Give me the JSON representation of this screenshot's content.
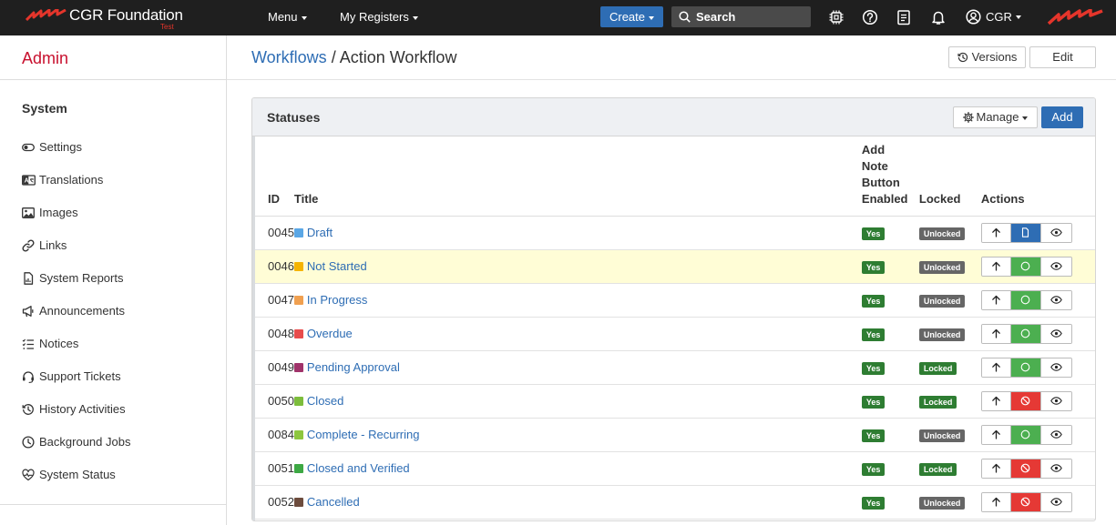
{
  "topbar": {
    "brand_name": "CGR Foundation",
    "brand_sub": "Test",
    "menu_label": "Menu",
    "registers_label": "My Registers",
    "create_label": "Create",
    "search_placeholder": "Search",
    "user_label": "CGR",
    "icons": [
      "chip-icon",
      "help-icon",
      "clipboard-icon",
      "bell-icon",
      "user-circle-icon"
    ]
  },
  "sidebar": {
    "title": "Admin",
    "section": "System",
    "items": [
      {
        "label": "Settings",
        "icon": "toggle-icon"
      },
      {
        "label": "Translations",
        "icon": "translate-icon"
      },
      {
        "label": "Images",
        "icon": "image-icon"
      },
      {
        "label": "Links",
        "icon": "link-icon"
      },
      {
        "label": "System Reports",
        "icon": "report-icon"
      },
      {
        "label": "Announcements",
        "icon": "megaphone-icon"
      },
      {
        "label": "Notices",
        "icon": "list-icon"
      },
      {
        "label": "Support Tickets",
        "icon": "headset-icon"
      },
      {
        "label": "History Activities",
        "icon": "history-icon"
      },
      {
        "label": "Background Jobs",
        "icon": "clock-icon"
      },
      {
        "label": "System Status",
        "icon": "heartbeat-icon"
      }
    ]
  },
  "header": {
    "breadcrumb_link": "Workflows",
    "breadcrumb_sep": "/",
    "title": "Action Workflow",
    "versions_label": "Versions",
    "edit_label": "Edit"
  },
  "panel": {
    "title": "Statuses",
    "manage_label": "Manage",
    "add_label": "Add",
    "columns": {
      "id": "ID",
      "title": "Title",
      "note_1": "Add",
      "note_2": "Note",
      "note_3": "Button",
      "note_4": "Enabled",
      "locked": "Locked",
      "actions": "Actions"
    },
    "rows": [
      {
        "id": "0045",
        "title": "Draft",
        "color": "#5aa7e6",
        "note": "Yes",
        "lock": "Unlocked",
        "state": "blue",
        "highlight": false
      },
      {
        "id": "0046",
        "title": "Not Started",
        "color": "#f5b400",
        "note": "Yes",
        "lock": "Unlocked",
        "state": "green",
        "highlight": true
      },
      {
        "id": "0047",
        "title": "In Progress",
        "color": "#f0a050",
        "note": "Yes",
        "lock": "Unlocked",
        "state": "green",
        "highlight": false
      },
      {
        "id": "0048",
        "title": "Overdue",
        "color": "#e84c4c",
        "note": "Yes",
        "lock": "Unlocked",
        "state": "green",
        "highlight": false
      },
      {
        "id": "0049",
        "title": "Pending Approval",
        "color": "#a0336a",
        "note": "Yes",
        "lock": "Locked",
        "state": "green",
        "highlight": false
      },
      {
        "id": "0050",
        "title": "Closed",
        "color": "#7dbd3c",
        "note": "Yes",
        "lock": "Locked",
        "state": "red",
        "highlight": false
      },
      {
        "id": "0084",
        "title": "Complete - Recurring",
        "color": "#8dc63f",
        "note": "Yes",
        "lock": "Unlocked",
        "state": "green",
        "highlight": false
      },
      {
        "id": "0051",
        "title": "Closed and Verified",
        "color": "#3da844",
        "note": "Yes",
        "lock": "Locked",
        "state": "red",
        "highlight": false
      },
      {
        "id": "0052",
        "title": "Cancelled",
        "color": "#6d4c3d",
        "note": "Yes",
        "lock": "Unlocked",
        "state": "red",
        "highlight": false
      }
    ]
  }
}
